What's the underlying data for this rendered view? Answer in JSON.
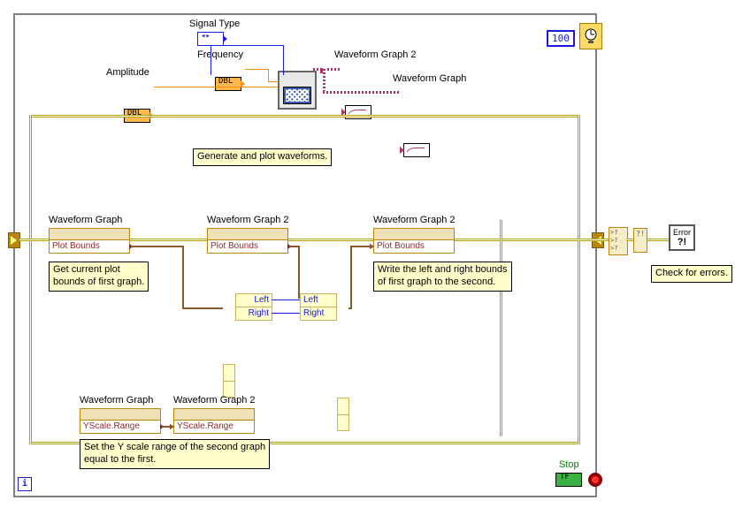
{
  "timer": {
    "ms": "100"
  },
  "controls": {
    "signal_type": {
      "label": "Signal Type"
    },
    "frequency": {
      "label": "Frequency",
      "type": "DBL"
    },
    "amplitude": {
      "label": "Amplitude",
      "type": "DBL"
    }
  },
  "indicators": {
    "wg2_top": {
      "label": "Waveform Graph 2"
    },
    "wg_top": {
      "label": "Waveform Graph"
    }
  },
  "comments": {
    "gen": "Generate and plot waveforms.",
    "get_bounds": "Get current plot\nbounds of first graph.",
    "write_bounds": "Write the left and right bounds\nof first graph to the second.",
    "yscale": "Set the Y scale range of the second graph\nequal to the first.",
    "check_err": "Check for errors."
  },
  "propnodes": {
    "wg1": {
      "label": "Waveform Graph",
      "prop": "Plot Bounds"
    },
    "wg2a": {
      "label": "Waveform Graph 2",
      "prop": "Plot Bounds"
    },
    "wg2b": {
      "label": "Waveform Graph 2",
      "prop": "Plot Bounds"
    },
    "yw1": {
      "label": "Waveform Graph",
      "prop": "YScale.Range"
    },
    "yw2": {
      "label": "Waveform Graph 2",
      "prop": "YScale.Range"
    }
  },
  "unbundle": {
    "left": "Left",
    "right": "Right"
  },
  "stop": {
    "label": "Stop"
  },
  "tf": "TF",
  "error": {
    "label": "Error"
  }
}
